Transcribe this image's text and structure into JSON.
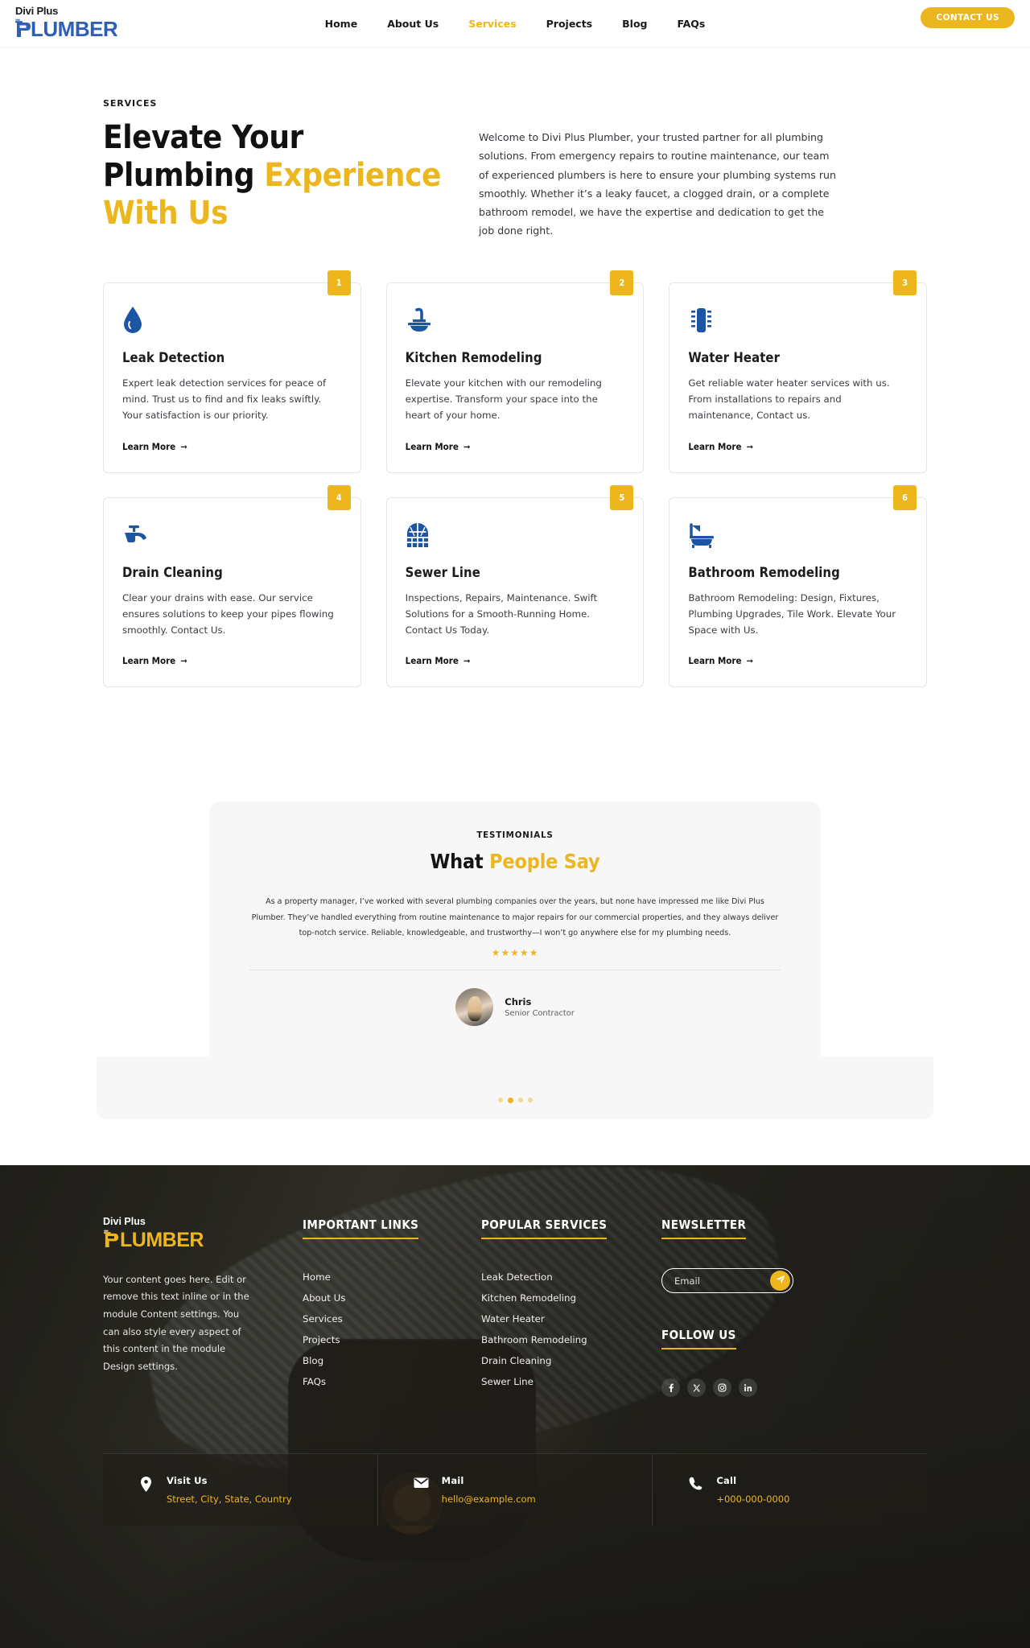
{
  "header": {
    "logo": {
      "top": "Divi Plus",
      "bottom": "LUMBER",
      "icon": "pipe-p-icon"
    },
    "nav": [
      {
        "label": "Home",
        "active": false
      },
      {
        "label": "About Us",
        "active": false
      },
      {
        "label": "Services",
        "active": true
      },
      {
        "label": "Projects",
        "active": false
      },
      {
        "label": "Blog",
        "active": false
      },
      {
        "label": "FAQs",
        "active": false
      }
    ],
    "cta_label": "CONTACT US"
  },
  "intro": {
    "eyebrow": "SERVICES",
    "title_plain": "Elevate Your Plumbing ",
    "title_accent": "Experience With Us",
    "paragraph": "Welcome to Divi Plus Plumber, your trusted partner for all plumbing solutions. From emergency repairs to routine maintenance, our team of experienced plumbers is here to ensure your plumbing systems run smoothly. Whether it’s a leaky faucet, a clogged drain, or a complete bathroom remodel, we have the expertise and dedication to get the job done right."
  },
  "services": {
    "learn_more_label": "Learn More",
    "cards": [
      {
        "number": "1",
        "icon": "water-drop-icon",
        "title": "Leak Detection",
        "desc": "Expert leak detection services for peace of mind. Trust us to find and fix leaks swiftly. Your satisfaction is our priority."
      },
      {
        "number": "2",
        "icon": "kitchen-sink-icon",
        "title": "Kitchen Remodeling",
        "desc": "Elevate your kitchen with our remodeling expertise. Transform your space into the heart of your home."
      },
      {
        "number": "3",
        "icon": "water-heater-icon",
        "title": "Water Heater",
        "desc": "Get reliable water heater services with us. From installations to repairs and maintenance, Contact us."
      },
      {
        "number": "4",
        "icon": "faucet-icon",
        "title": "Drain Cleaning",
        "desc": "Clear your drains with ease. Our service ensures solutions to keep your pipes flowing smoothly. Contact Us."
      },
      {
        "number": "5",
        "icon": "sewer-manhole-icon",
        "title": "Sewer Line",
        "desc": "Inspections, Repairs, Maintenance. Swift Solutions for a Smooth-Running Home. Contact Us Today."
      },
      {
        "number": "6",
        "icon": "bathtub-icon",
        "title": "Bathroom Remodeling",
        "desc": "Bathroom Remodeling: Design, Fixtures, Plumbing Upgrades, Tile Work. Elevate Your Space with Us."
      }
    ]
  },
  "testimonials": {
    "eyebrow": "TESTIMONIALS",
    "title_plain": "What ",
    "title_accent": "People Say",
    "quote": "As a property manager, I’ve worked with several plumbing companies over the years, but none have impressed me like Divi Plus Plumber. They’ve handled everything from routine maintenance to major repairs for our commercial properties, and they always deliver top-notch service. Reliable, knowledgeable, and trustworthy—I won’t go anywhere else for my plumbing needs.",
    "stars": "★★★★★",
    "rating": 5,
    "author_name": "Chris",
    "author_role": "Senior Contractor",
    "dots": 4,
    "active_dot": 2
  },
  "footer": {
    "logo": {
      "top": "Divi Plus",
      "bottom": "LUMBER",
      "icon": "pipe-p-icon"
    },
    "about_text": "Your content goes here. Edit or remove this text inline or in the module Content settings. You can also style every aspect of this content in the module Design settings.",
    "links_heading": "IMPORTANT LINKS",
    "links": [
      {
        "label": "Home"
      },
      {
        "label": "About Us"
      },
      {
        "label": "Services"
      },
      {
        "label": "Projects"
      },
      {
        "label": "Blog"
      },
      {
        "label": "FAQs"
      }
    ],
    "services_heading": "POPULAR SERVICES",
    "services": [
      {
        "label": "Leak Detection"
      },
      {
        "label": "Kitchen Remodeling"
      },
      {
        "label": "Water Heater"
      },
      {
        "label": "Bathroom Remodeling"
      },
      {
        "label": "Drain Cleaning"
      },
      {
        "label": "Sewer Line"
      }
    ],
    "newsletter_heading": "NEWSLETTER",
    "email_placeholder": "Email",
    "email_value": "",
    "send_icon": "paper-plane-icon",
    "follow_heading": "FOLLOW US",
    "socials": [
      {
        "name": "facebook-icon",
        "glyph": "f"
      },
      {
        "name": "x-twitter-icon",
        "glyph": "𝕏"
      },
      {
        "name": "instagram-icon",
        "glyph": "□"
      },
      {
        "name": "linkedin-icon",
        "glyph": "in"
      }
    ],
    "contacts": [
      {
        "icon": "location-pin-icon",
        "label": "Visit Us",
        "value": "Street, City, State, Country"
      },
      {
        "icon": "envelope-icon",
        "label": "Mail",
        "value": "hello@example.com"
      },
      {
        "icon": "phone-icon",
        "label": "Call",
        "value": "+000-000-0000"
      }
    ]
  },
  "colors": {
    "accent_yellow": "#eeb61d",
    "brand_blue": "#1d55a5",
    "logo_blue": "#2f5fb5",
    "dark": "#1e1d19",
    "card_border": "#e6e6e6",
    "testimonial_bg": "#f7f7f7"
  }
}
